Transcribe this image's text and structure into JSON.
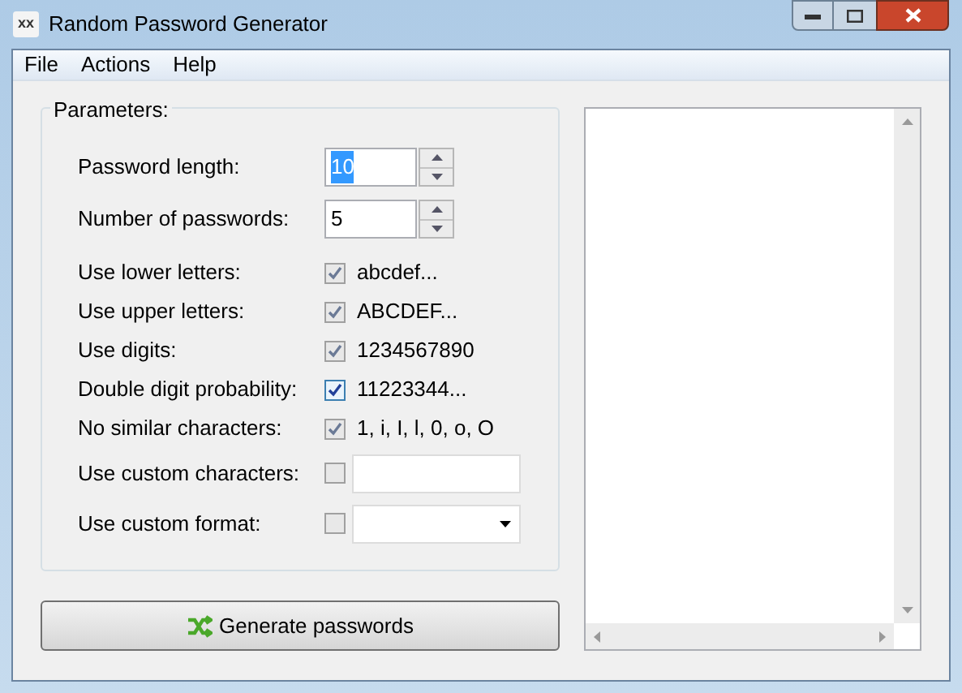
{
  "window": {
    "app_icon": "xx",
    "title": "Random Password Generator"
  },
  "menu": [
    "File",
    "Actions",
    "Help"
  ],
  "parameters": {
    "title": "Parameters:",
    "spinners": [
      {
        "label": "Password length:",
        "value": "10",
        "selected": true
      },
      {
        "label": "Number of passwords:",
        "value": "5",
        "selected": false
      }
    ],
    "options": [
      {
        "kind": "check",
        "label": "Use lower letters:",
        "checked": true,
        "disabled": true,
        "text": "abcdef..."
      },
      {
        "kind": "check",
        "label": "Use upper letters:",
        "checked": true,
        "disabled": true,
        "text": "ABCDEF..."
      },
      {
        "kind": "check",
        "label": "Use digits:",
        "checked": true,
        "disabled": true,
        "text": "1234567890"
      },
      {
        "kind": "check",
        "label": "Double digit probability:",
        "checked": true,
        "disabled": false,
        "text": "11223344..."
      },
      {
        "kind": "check",
        "label": "No similar characters:",
        "checked": true,
        "disabled": true,
        "text": "1, i, I, l, 0, o, O"
      },
      {
        "kind": "field",
        "label": "Use custom characters:",
        "checked": false,
        "disabled": true
      },
      {
        "kind": "combo",
        "label": "Use custom format:",
        "checked": false,
        "disabled": true
      }
    ]
  },
  "generate_button": "Generate passwords"
}
